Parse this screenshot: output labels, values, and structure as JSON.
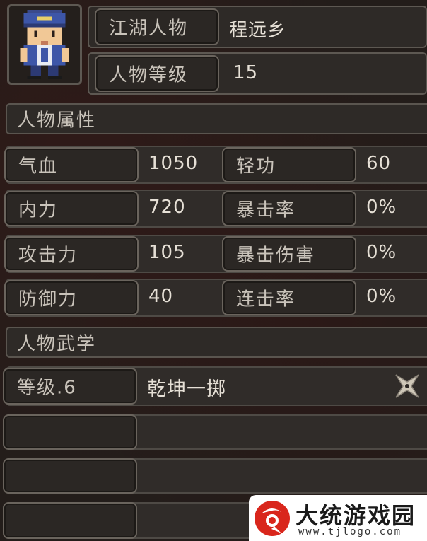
{
  "character": {
    "name_label": "江湖人物",
    "name_value": "程远乡",
    "level_label": "人物等级",
    "level_value": "15"
  },
  "attributes": {
    "section_title": "人物属性",
    "left": [
      {
        "label": "气血",
        "value": "1050"
      },
      {
        "label": "内力",
        "value": "720"
      },
      {
        "label": "攻击力",
        "value": "105"
      },
      {
        "label": "防御力",
        "value": "40"
      }
    ],
    "right": [
      {
        "label": "轻功",
        "value": "60"
      },
      {
        "label": "暴击率",
        "value": "0%"
      },
      {
        "label": "暴击伤害",
        "value": "0%"
      },
      {
        "label": "连击率",
        "value": "0%"
      }
    ]
  },
  "martial_arts": {
    "section_title": "人物武学",
    "skills": [
      {
        "level_label": "等级.6",
        "name": "乾坤一掷",
        "icon": "shuriken-icon"
      },
      {
        "level_label": "",
        "name": ""
      },
      {
        "level_label": "",
        "name": ""
      },
      {
        "level_label": "",
        "name": ""
      }
    ]
  },
  "watermark": {
    "brand_text": "大统游戏园",
    "url_text": "www.tjlogo.com",
    "logo_icon": "brand-logo-icon",
    "accent_color": "#d9261c"
  }
}
